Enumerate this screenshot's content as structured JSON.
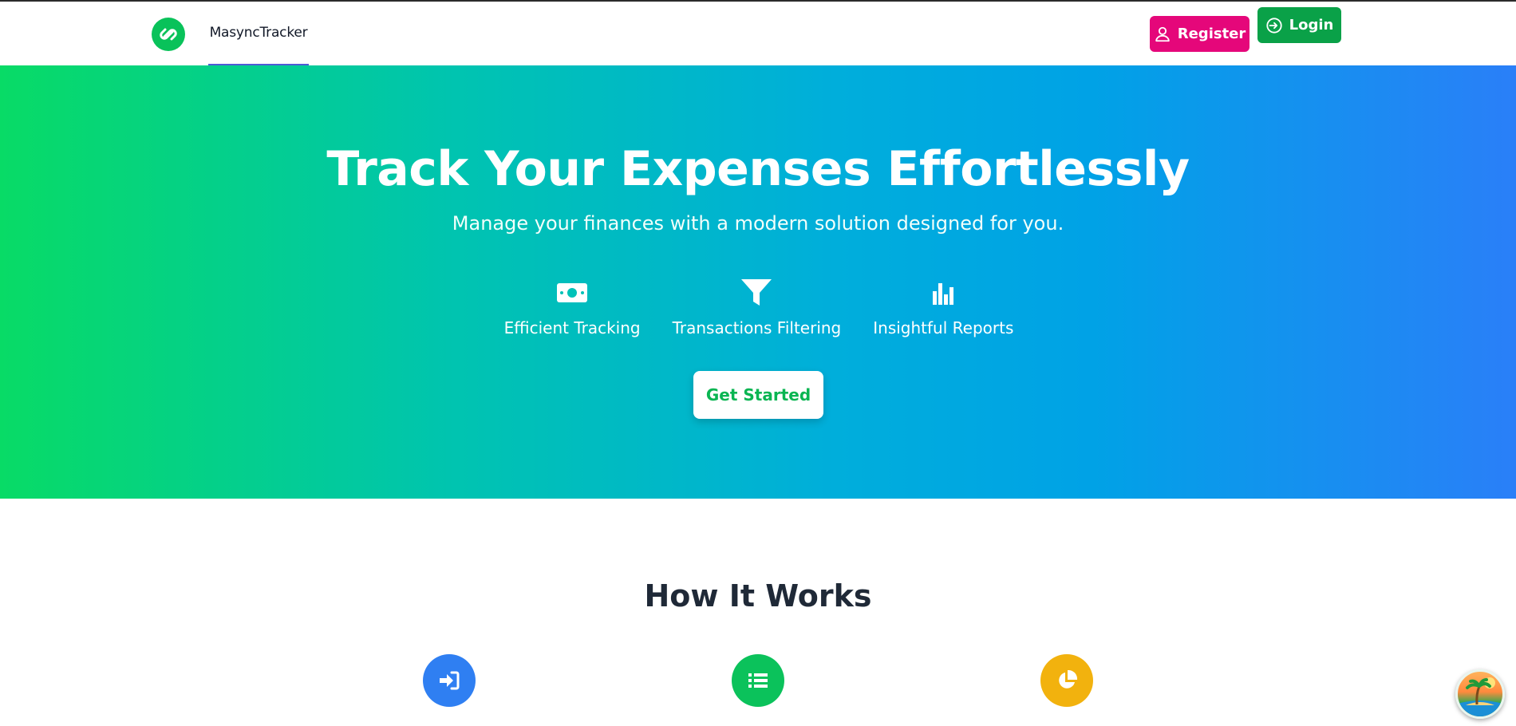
{
  "header": {
    "brand": "MasyncTracker",
    "register_label": "Register",
    "login_label": "Login"
  },
  "hero": {
    "title": "Track Your Expenses Effortlessly",
    "subtitle": "Manage your finances with a modern solution designed for you.",
    "features": [
      {
        "label": "Efficient Tracking",
        "icon": "money-bill-icon"
      },
      {
        "label": "Transactions Filtering",
        "icon": "filter-funnel-icon"
      },
      {
        "label": "Insightful Reports",
        "icon": "bar-chart-icon"
      }
    ],
    "cta_label": "Get Started"
  },
  "how": {
    "title": "How It Works",
    "steps": [
      {
        "icon": "sign-in-icon",
        "color": "#2f7ff2"
      },
      {
        "icon": "list-icon",
        "color": "#0bc25b"
      },
      {
        "icon": "pie-chart-icon",
        "color": "#f2b20e"
      }
    ]
  },
  "colors": {
    "brand_green": "#09c25a",
    "register_pink": "#e5077a",
    "login_green": "#0aa148",
    "hero_gradient_start": "#08db66",
    "hero_gradient_end": "#2a7ff8"
  }
}
